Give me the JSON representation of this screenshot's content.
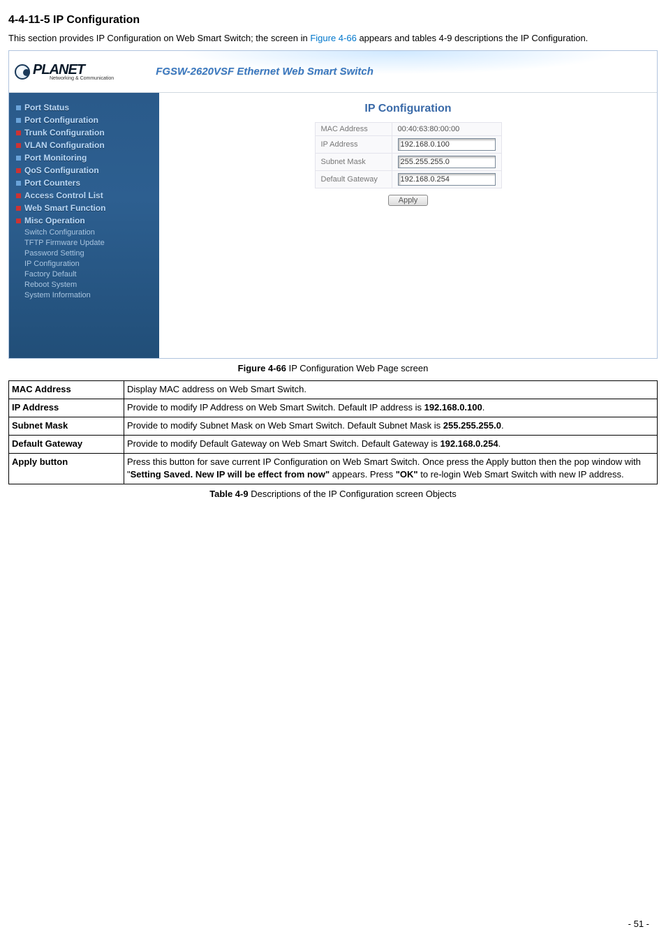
{
  "section": {
    "heading": "4-4-11-5 IP Configuration"
  },
  "intro": {
    "pre": "This section provides IP Configuration on Web Smart Switch; the screen in ",
    "link": "Figure 4-66",
    "post": " appears and tables 4-9 descriptions the IP Configuration."
  },
  "shot": {
    "logo_brand": "PLANET",
    "logo_sub": "Networking & Communication",
    "header_title": "FGSW-2620VSF Ethernet Web Smart Switch",
    "nav": [
      {
        "label": "Port Status",
        "color": "blue"
      },
      {
        "label": "Port Configuration",
        "color": "blue"
      },
      {
        "label": "Trunk Configuration",
        "color": "red"
      },
      {
        "label": "VLAN Configuration",
        "color": "red"
      },
      {
        "label": "Port Monitoring",
        "color": "blue"
      },
      {
        "label": "QoS Configuration",
        "color": "red"
      },
      {
        "label": "Port Counters",
        "color": "blue"
      },
      {
        "label": "Access Control List",
        "color": "red"
      },
      {
        "label": "Web Smart Function",
        "color": "red"
      },
      {
        "label": "Misc Operation",
        "color": "red"
      }
    ],
    "subnav": [
      "Switch Configuration",
      "TFTP Firmware Update",
      "Password Setting",
      "IP Configuration",
      "Factory Default",
      "Reboot System",
      "System Information"
    ],
    "pane_title": "IP Configuration",
    "fields": {
      "mac_label": "MAC Address",
      "mac_value": "00:40:63:80:00:00",
      "ip_label": "IP Address",
      "ip_value": "192.168.0.100",
      "mask_label": "Subnet Mask",
      "mask_value": "255.255.255.0",
      "gw_label": "Default Gateway",
      "gw_value": "192.168.0.254"
    },
    "apply": "Apply"
  },
  "fig_caption": {
    "bold": "Figure 4-66",
    "rest": " IP Configuration Web Page screen"
  },
  "desc_rows": [
    {
      "obj": "MAC Address",
      "text": "Display MAC address on Web Smart Switch."
    },
    {
      "obj": "IP Address",
      "pre": "Provide to modify IP Address on Web Smart Switch. Default IP address is ",
      "val": "192.168.0.100",
      "post": "."
    },
    {
      "obj": "Subnet Mask",
      "pre": "Provide to modify Subnet Mask on Web Smart Switch. Default Subnet Mask is ",
      "val": "255.255.255.0",
      "post": "."
    },
    {
      "obj": "Default Gateway",
      "pre": "Provide to modify Default Gateway on Web Smart Switch. Default Gateway is ",
      "val": "192.168.0.254",
      "post": "."
    },
    {
      "obj": "Apply button",
      "line1a": "Press this button for save current IP Configuration on Web Smart Switch. Once press the Apply button then the pop window with \"",
      "line1b": "Setting Saved. New IP will be effect from now\"",
      "line1c": " appears. Press ",
      "line2a": "\"OK\"",
      "line2b": " to re-login Web Smart Switch with new IP address."
    }
  ],
  "table_caption": {
    "bold": "Table 4-9",
    "rest": " Descriptions of the IP Configuration screen Objects"
  },
  "footer": "- 51 -"
}
